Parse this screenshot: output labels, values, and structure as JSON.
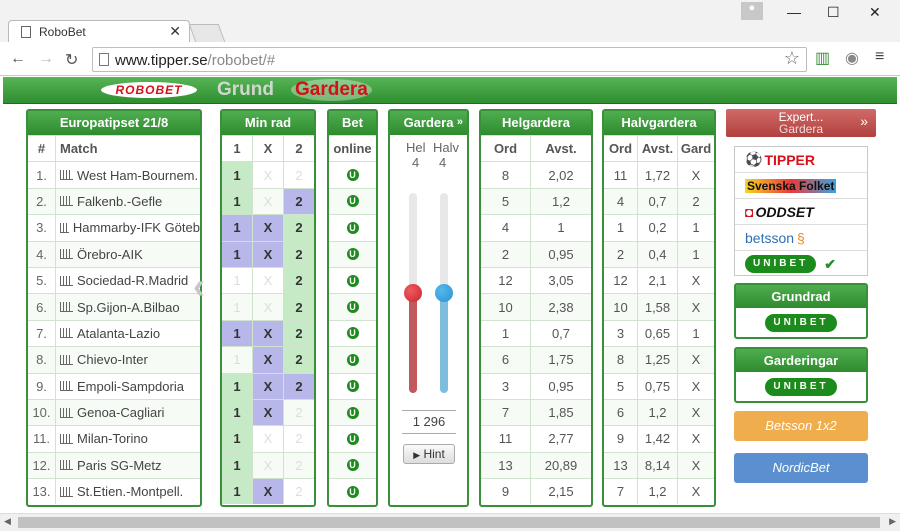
{
  "browser": {
    "tab_title": "RoboBet",
    "url_host": "www.tipper.se",
    "url_path": "/robobet/#"
  },
  "site": {
    "logo": "ROBOBET",
    "nav_grund": "Grund",
    "nav_gardera": "Gardera"
  },
  "matches": {
    "title": "Europatipset 21/8",
    "col_num": "#",
    "col_match": "Match",
    "rows": [
      {
        "n": "1.",
        "m": "West Ham-Bournem."
      },
      {
        "n": "2.",
        "m": "Falkenb.-Gefle"
      },
      {
        "n": "3.",
        "m": "Hammarby-IFK Göteb"
      },
      {
        "n": "4.",
        "m": "Örebro-AIK"
      },
      {
        "n": "5.",
        "m": "Sociedad-R.Madrid"
      },
      {
        "n": "6.",
        "m": "Sp.Gijon-A.Bilbao"
      },
      {
        "n": "7.",
        "m": "Atalanta-Lazio"
      },
      {
        "n": "8.",
        "m": "Chievo-Inter"
      },
      {
        "n": "9.",
        "m": "Empoli-Sampdoria"
      },
      {
        "n": "10.",
        "m": "Genoa-Cagliari"
      },
      {
        "n": "11.",
        "m": "Milan-Torino"
      },
      {
        "n": "12.",
        "m": "Paris SG-Metz"
      },
      {
        "n": "13.",
        "m": "St.Etien.-Montpell."
      }
    ]
  },
  "minrad": {
    "title": "Min rad",
    "cols": [
      "1",
      "X",
      "2"
    ],
    "rows": [
      [
        "g1",
        "d",
        "d"
      ],
      [
        "g1",
        "d",
        "b2"
      ],
      [
        "b1",
        "bX",
        "g2"
      ],
      [
        "b1",
        "bX",
        "g2"
      ],
      [
        "d",
        "d",
        "g2"
      ],
      [
        "d",
        "d",
        "g2"
      ],
      [
        "b1",
        "bX",
        "g2"
      ],
      [
        "d",
        "bX",
        "g2"
      ],
      [
        "g1",
        "bX",
        "b2"
      ],
      [
        "g1",
        "bX",
        "d"
      ],
      [
        "g1",
        "d",
        "d"
      ],
      [
        "g1",
        "d",
        "d"
      ],
      [
        "g1",
        "bX",
        "d"
      ]
    ]
  },
  "bet": {
    "title": "Bet",
    "col": "online",
    "icon": "U"
  },
  "gardera": {
    "title": "Gardera",
    "hel_label": "Hel",
    "halv_label": "Halv",
    "hel_value": "4",
    "halv_value": "4",
    "hel_level": 0.5,
    "halv_level": 0.5,
    "count": "1 296",
    "hint": "Hint",
    "hel_color": "#c9262c",
    "halv_color": "#2b93d1"
  },
  "helgardera": {
    "title": "Helgardera",
    "cols": [
      "Ord",
      "Avst."
    ],
    "rows": [
      [
        "8",
        "2,02"
      ],
      [
        "5",
        "1,2"
      ],
      [
        "4",
        "1"
      ],
      [
        "2",
        "0,95"
      ],
      [
        "12",
        "3,05"
      ],
      [
        "10",
        "2,38"
      ],
      [
        "1",
        "0,7"
      ],
      [
        "6",
        "1,75"
      ],
      [
        "3",
        "0,95"
      ],
      [
        "7",
        "1,85"
      ],
      [
        "11",
        "2,77"
      ],
      [
        "13",
        "20,89"
      ],
      [
        "9",
        "2,15"
      ]
    ]
  },
  "halvgardera": {
    "title": "Halvgardera",
    "cols": [
      "Ord",
      "Avst.",
      "Gard"
    ],
    "rows": [
      [
        "11",
        "1,72",
        "X"
      ],
      [
        "4",
        "0,7",
        "2"
      ],
      [
        "1",
        "0,2",
        "1"
      ],
      [
        "2",
        "0,4",
        "1"
      ],
      [
        "12",
        "2,1",
        "X"
      ],
      [
        "10",
        "1,58",
        "X"
      ],
      [
        "3",
        "0,65",
        "1"
      ],
      [
        "8",
        "1,25",
        "X"
      ],
      [
        "5",
        "0,75",
        "X"
      ],
      [
        "6",
        "1,2",
        "X"
      ],
      [
        "9",
        "1,42",
        "X"
      ],
      [
        "13",
        "8,14",
        "X"
      ],
      [
        "7",
        "1,2",
        "X"
      ]
    ]
  },
  "side": {
    "expert_title": "Expert...",
    "expert_sub": "Gardera",
    "books": [
      "TIPPER",
      "Svenska Folket",
      "ODDSET",
      "betsson",
      "UNIBET"
    ],
    "grundrad_title": "Grundrad",
    "grundrad_book": "UNIBET",
    "garderingar_title": "Garderingar",
    "garderingar_book": "UNIBET",
    "betsson_btn": "Betsson 1x2",
    "nordic_btn": "NordicBet",
    "colors": {
      "green": "#2e8b2e",
      "red": "#d4111a",
      "orange": "#f0ad4e",
      "blue": "#5b8fcf",
      "expert": "#c0504d"
    }
  }
}
